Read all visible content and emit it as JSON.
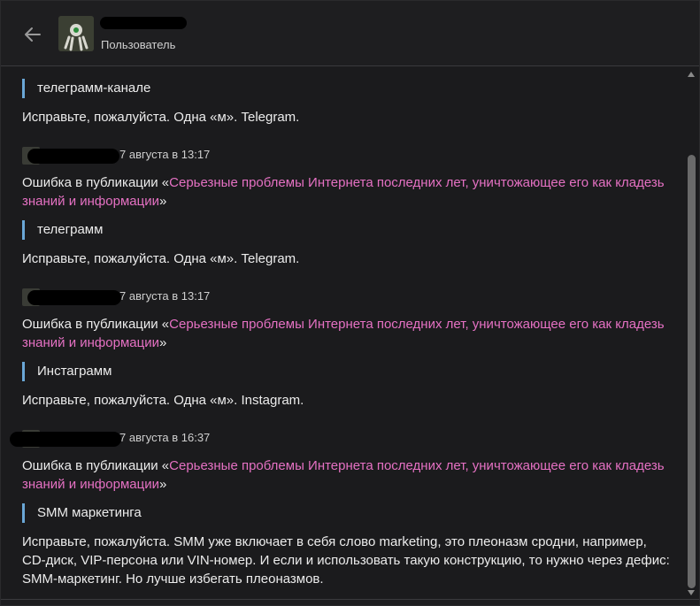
{
  "header": {
    "role": "Пользователь",
    "back_icon": "arrow-left-icon"
  },
  "feed": [
    {
      "quote": "телеграмм-канале",
      "text": "Исправьте, пожалуйста. Одна «м». Telegram."
    },
    {
      "date": "7 августа в 13:17",
      "prefix": "Ошибка в публикации «",
      "link": "Серьезные проблемы Интернета последних лет, уничтожающее его как кладезь знаний и информации",
      "suffix": "»"
    },
    {
      "quote": "телеграмм",
      "text": "Исправьте, пожалуйста. Одна «м». Telegram."
    },
    {
      "date": "7 августа в 13:17",
      "prefix": "Ошибка в публикации «",
      "link": "Серьезные проблемы Интернета последних лет, уничтожающее его как кладезь знаний и информации",
      "suffix": "»"
    },
    {
      "quote": "Инстаграмм",
      "text": "Исправьте, пожалуйста. Одна «м». Instagram."
    },
    {
      "date": "7 августа в 16:37",
      "prefix": "Ошибка в публикации «",
      "link": "Серьезные проблемы Интернета последних лет, уничтожающее его как кладезь знаний и информации",
      "suffix": "»"
    },
    {
      "quote": "SMM маркетинга",
      "text": "Исправьте, пожалуйста. SMM уже включает в себя слово marketing, это плеоназм сродни, например, CD-диск, VIP-персона или VIN-номер. И если и использовать такую конструкцию, то нужно через дефис: SMM-маркетинг. Но лучше избегать плеоназмов."
    }
  ],
  "colors": {
    "link": "#e571c3",
    "quote_bar": "#6aa7d6",
    "background": "#1b1b1d"
  }
}
